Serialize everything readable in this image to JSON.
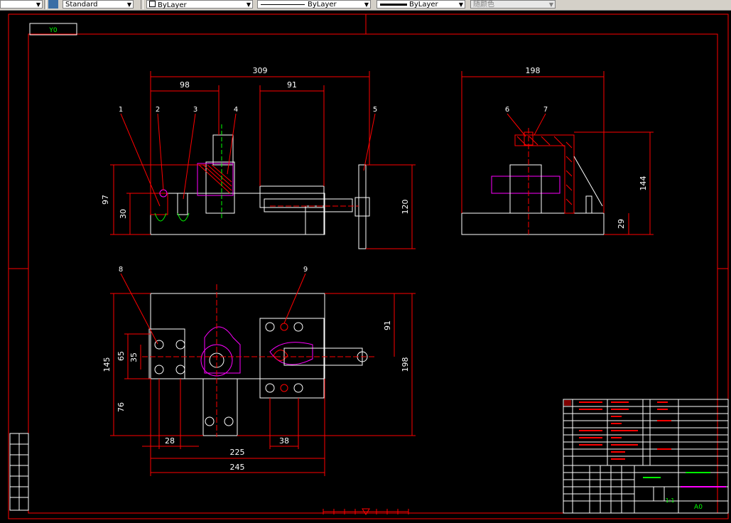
{
  "toolbar": {
    "text_style": "Standard",
    "layer": "ByLayer",
    "linetype": "ByLayer",
    "lineweight": "ByLayer",
    "color": "随颜色"
  },
  "viewport_tag": "Y0",
  "dimensions": {
    "front_overall": "309",
    "front_98": "98",
    "front_91": "91",
    "front_97": "97",
    "front_30": "30",
    "front_120": "120",
    "side_198": "198",
    "side_144": "144",
    "side_29": "29",
    "top_91": "91",
    "top_145": "145",
    "top_65": "65",
    "top_35": "35",
    "top_76": "76",
    "top_198": "198",
    "top_28": "28",
    "top_38": "38",
    "top_225": "225",
    "top_245": "245"
  },
  "part_balloons": [
    "1",
    "2",
    "3",
    "4",
    "5",
    "6",
    "7",
    "8",
    "9"
  ],
  "title_block": {
    "scale": "1:1",
    "sheet": "A0"
  },
  "colors": {
    "background": "#000000",
    "border": "#ff0000",
    "geometry": "#ffffff",
    "dimension": "#ff0000",
    "magenta": "#ff00ff",
    "green": "#00ff00"
  }
}
